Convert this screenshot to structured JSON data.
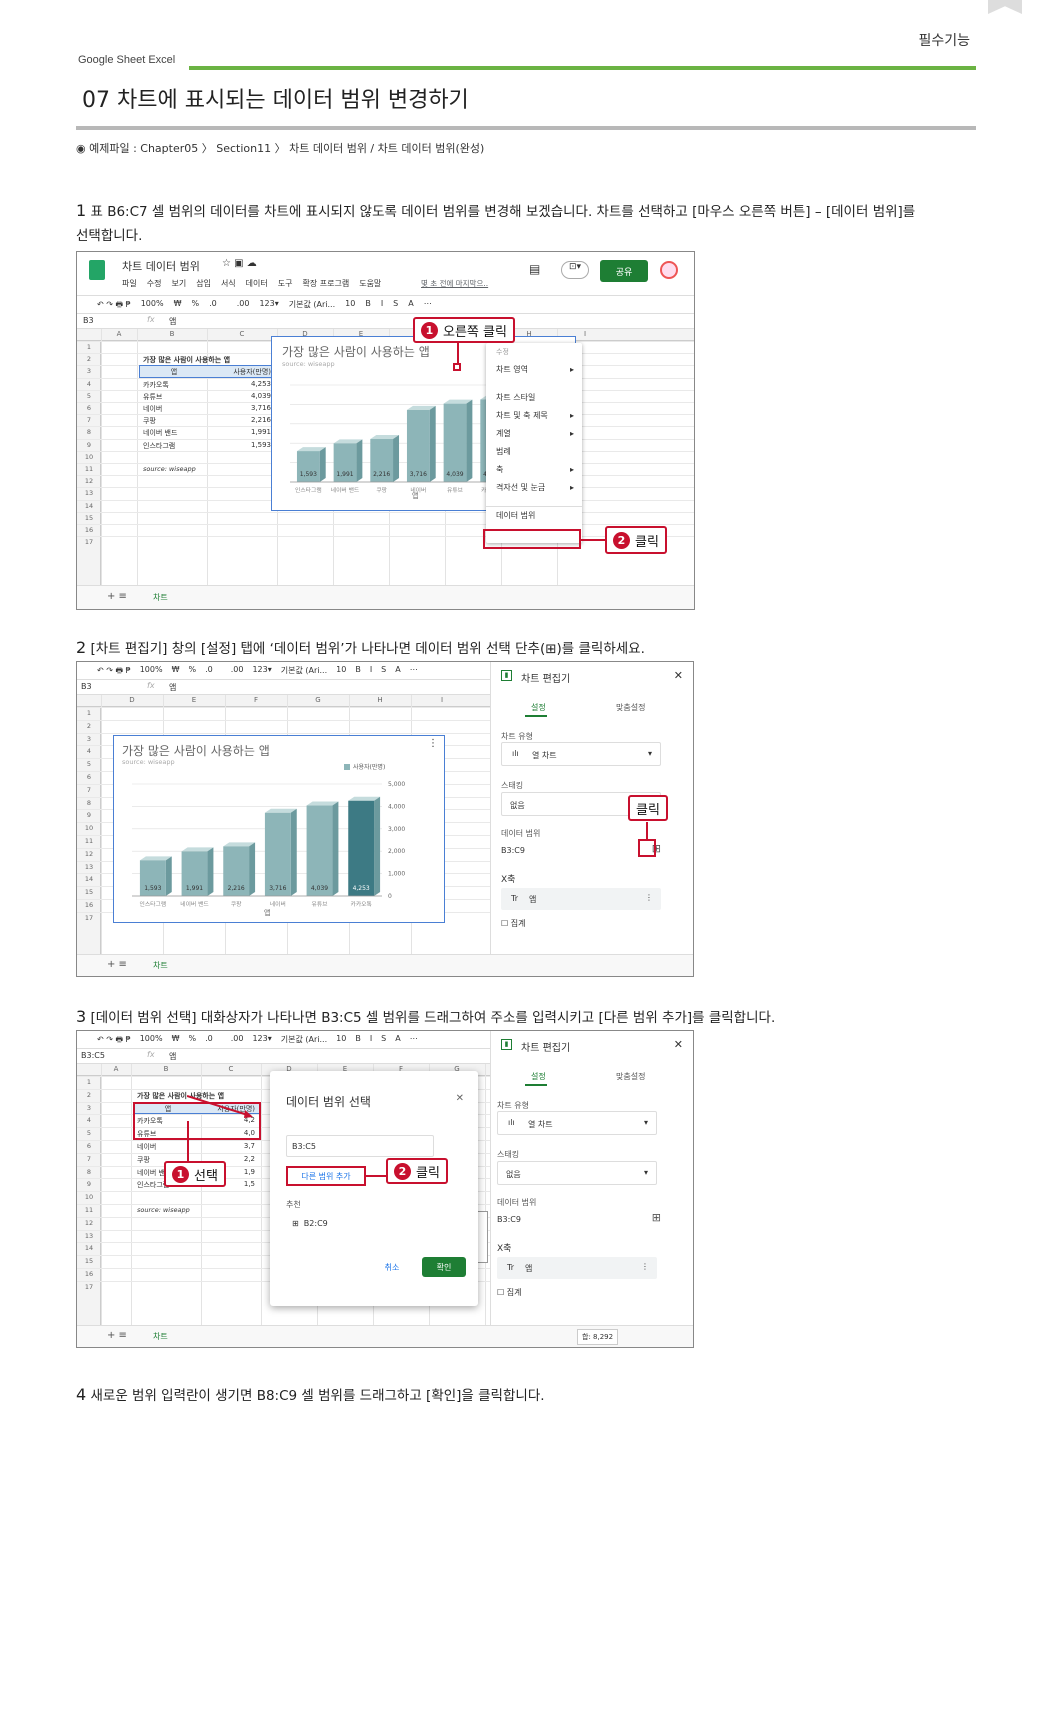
{
  "header": {
    "section_label": "필수기능",
    "brand": "Google Sheet  Excel",
    "title": "07 차트에 표시되는 데이터 범위 변경하기",
    "example": "◉ 예제파일 : Chapter05 〉 Section11 〉 차트 데이터 범위 / 차트 데이터 범위(완성)"
  },
  "steps": [
    {
      "num": "1",
      "text": "표 B6:C7 셀 범위의 데이터를 차트에 표시되지 않도록 데이터 범위를 변경해 보겠습니다. 차트를 선택하고 [마우스 오른쪽 버튼] – [데이터 범위]를",
      "text2": "선택합니다."
    },
    {
      "num": "2",
      "text": "[차트 편집기] 창의 [설정] 탭에 ‘데이터 범위’가 나타나면 데이터 범위 선택 단추(⊞)를 클릭하세요."
    },
    {
      "num": "3",
      "text": "[데이터 범위 선택] 대화상자가 나타나면 B3:C5 셀 범위를 드래그하여 주소를 입력시키고 [다른 범위 추가]를 클릭합니다."
    },
    {
      "num": "4",
      "text": "새로운 범위 입력란이 생기면 B8:C9 셀 범위를 드래그하고 [확인]을 클릭합니다."
    }
  ],
  "sheet": {
    "doc_title": "차트 데이터 범위",
    "menus": [
      "파일",
      "수정",
      "보기",
      "삽입",
      "서식",
      "데이터",
      "도구",
      "확장 프로그램",
      "도움말"
    ],
    "last_edit": "몇 초 전에 마지막으..",
    "share": "공유",
    "toolbar": [
      "100%",
      "₩",
      "%",
      ".0",
      "",
      ".00",
      "123▾",
      "기본값 (Ari...",
      "10",
      "B",
      "I",
      "S",
      "A"
    ],
    "cell_ref": "B3",
    "cell_ref3": "B3:C5",
    "fx": "fx",
    "formula": "앱",
    "cols": [
      "A",
      "B",
      "C",
      "D",
      "E",
      "F",
      "G",
      "H",
      "I"
    ],
    "cols2": [
      "D",
      "E",
      "F",
      "G",
      "H",
      "I"
    ],
    "rows": [
      "1",
      "2",
      "3",
      "4",
      "5",
      "6",
      "7",
      "8",
      "9",
      "10",
      "11",
      "12",
      "13",
      "14",
      "15",
      "16",
      "17"
    ],
    "table_title": "가장 많은 사람이 사용하는 앱",
    "table_headers": [
      "앱",
      "사용자(만명)"
    ],
    "table_rows": [
      [
        "카카오톡",
        "4,253"
      ],
      [
        "유튜브",
        "4,039"
      ],
      [
        "네이버",
        "3,716"
      ],
      [
        "쿠팡",
        "2,216"
      ],
      [
        "네이버 밴드",
        "1,991"
      ],
      [
        "인스타그램",
        "1,593"
      ]
    ],
    "table_rows3": [
      [
        "카카오톡",
        "4,2"
      ],
      [
        "유튜브",
        "4,0"
      ],
      [
        "네이버",
        "3,7"
      ],
      [
        "쿠팡",
        "2,2"
      ],
      [
        "네이버 밴드",
        "1,9"
      ],
      [
        "인스타그램",
        "1,5"
      ]
    ],
    "source": "source: wiseapp",
    "sheet_tab": "차트",
    "sum_label": "합: 8,292"
  },
  "chart_data": {
    "type": "bar",
    "title": "가장 많은 사람이 사용하는 앱",
    "subtitle": "source: wiseapp",
    "categories": [
      "인스타그램",
      "네이버 밴드",
      "쿠팡",
      "네이버",
      "유튜브",
      "카카오톡"
    ],
    "series": [
      {
        "name": "사용자(만명)",
        "values": [
          1593,
          1991,
          2216,
          3716,
          4039,
          4253
        ]
      }
    ],
    "labels": [
      "1,593",
      "1,991",
      "2,216",
      "3,716",
      "4,039",
      "4,253"
    ],
    "xlabel": "앱",
    "ylabel": "",
    "ylim": [
      0,
      5000
    ],
    "yticks": [
      "5,000",
      "4,000",
      "3,000",
      "2,000",
      "1,000",
      "0"
    ],
    "legend": "top-right",
    "color": "#8db5b8",
    "highlight_color": "#3d7a84"
  },
  "context_menu": {
    "header": "수정",
    "items": [
      "차트 영역",
      "차트 스타일",
      "차트 및 축 제목",
      "계열",
      "범례",
      "축",
      "격자선 및 눈금",
      "데이터 범위"
    ]
  },
  "editor": {
    "title": "차트 편집기",
    "tabs": [
      "설정",
      "맞춤설정"
    ],
    "chart_type_label": "차트 유형",
    "chart_type": "열 차트",
    "stacking_label": "스태킹",
    "stacking": "없음",
    "range_label": "데이터 범위",
    "range": "B3:C9",
    "x_label": "X축",
    "x_value": "앱",
    "aggregate": "집계"
  },
  "dialog": {
    "title": "데이터 범위 선택",
    "value": "B3:C5",
    "add_range": "다른 범위 추가",
    "suggest_label": "추천",
    "suggest": "B2:C9",
    "cancel": "취소",
    "ok": "확인"
  },
  "callouts": {
    "right_click": "오른쪽 클릭",
    "click": "클릭",
    "select": "선택",
    "n1": "1",
    "n2": "2"
  }
}
